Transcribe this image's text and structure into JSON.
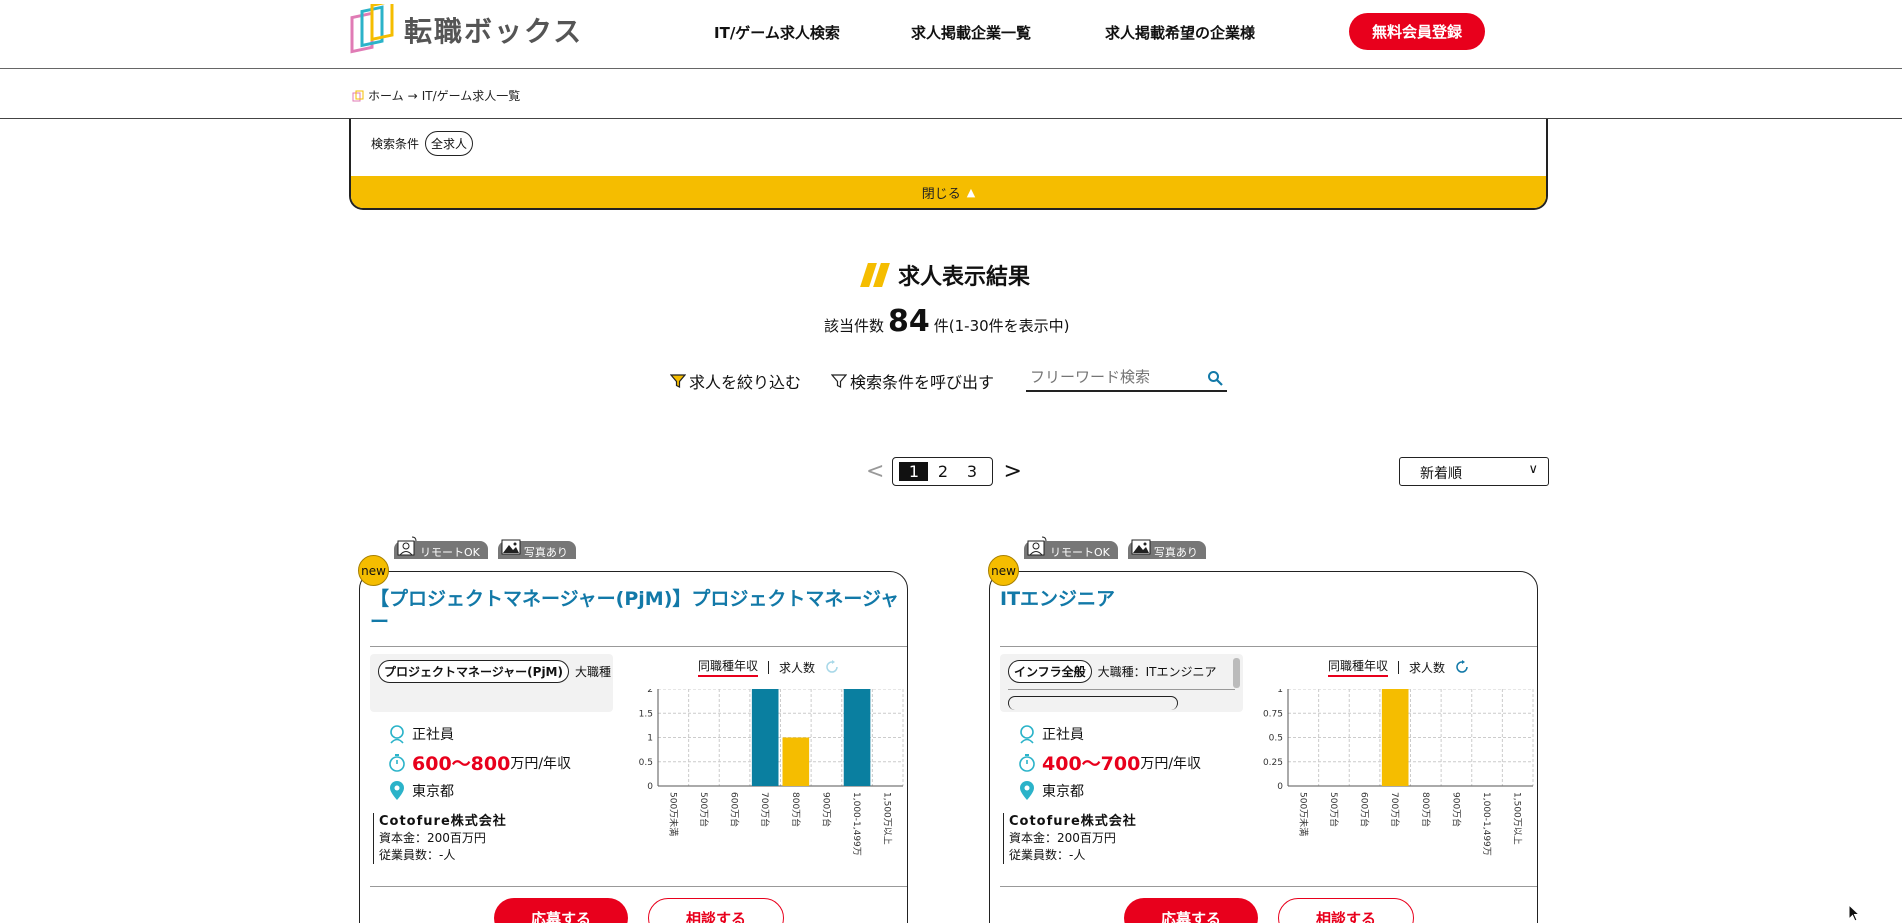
{
  "header": {
    "logo_text": "転職ボックス",
    "nav": [
      "IT/ゲーム求人検索",
      "求人掲載企業一覧",
      "求人掲載希望の企業様"
    ],
    "cta": "無料会員登録"
  },
  "breadcrumb": {
    "home": "ホーム",
    "arrow": "→",
    "current": "IT/ゲーム求人一覧"
  },
  "search_panel": {
    "condition_label": "検索条件",
    "condition_value": "全求人",
    "close_label": "閉じる"
  },
  "results": {
    "title": "求人表示結果",
    "count_prefix": "該当件数",
    "count": "84",
    "count_suffix": "件(1-30件を表示中)",
    "filter_label": "求人を絞り込む",
    "saved_label": "検索条件を呼び出す",
    "search_placeholder": "フリーワード検索"
  },
  "pager": {
    "prev": "<",
    "pages": [
      "1",
      "2",
      "3"
    ],
    "active": "1",
    "next": ">"
  },
  "sort": {
    "selected": "新着順"
  },
  "cards": [
    {
      "new_label": "new",
      "tags": [
        "リモートOK",
        "写真あり"
      ],
      "title": "【プロジェクトマネージャー(PjM)】プロジェクトマネージャー",
      "category_chip": "プロジェクトマネージャー(PjM)",
      "category_text": "大職種",
      "employment": "正社員",
      "salary": "600〜800",
      "salary_unit": "万円/年収",
      "location": "東京都",
      "company": "Cotofure株式会社",
      "capital": "資本金：200百万円",
      "employees": "従業員数：-人",
      "chart_tab_1": "同職種年収",
      "chart_tab_2": "求人数",
      "apply": "応募する",
      "consult": "相談する"
    },
    {
      "new_label": "new",
      "tags": [
        "リモートOK",
        "写真あり"
      ],
      "title": "ITエンジニア",
      "category_chip": "インフラ全般",
      "category_text": "大職種：ITエンジニア",
      "employment": "正社員",
      "salary": "400〜700",
      "salary_unit": "万円/年収",
      "location": "東京都",
      "company": "Cotofure株式会社",
      "capital": "資本金：200百万円",
      "employees": "従業員数：-人",
      "chart_tab_1": "同職種年収",
      "chart_tab_2": "求人数",
      "apply": "応募する",
      "consult": "相談する"
    }
  ],
  "colors": {
    "accent_red": "#e8001c",
    "accent_yellow": "#f5bd00",
    "teal": "#0a7fa0",
    "title_blue": "#1279a8"
  },
  "chart_data": [
    {
      "type": "bar",
      "categories": [
        "500万未満",
        "500万台",
        "600万台",
        "700万台",
        "800万台",
        "900万台",
        "1,000-1,499万",
        "1,500万以上"
      ],
      "values": [
        0,
        0,
        0,
        2,
        1,
        0,
        2,
        0
      ],
      "highlight": [
        false,
        false,
        false,
        false,
        true,
        false,
        false,
        false
      ],
      "yticks": [
        "0",
        "0.5",
        "1",
        "1.5",
        "2"
      ],
      "ylim": [
        0,
        2
      ]
    },
    {
      "type": "bar",
      "categories": [
        "500万未満",
        "500万台",
        "600万台",
        "700万台",
        "800万台",
        "900万台",
        "1,000-1,499万",
        "1,500万以上"
      ],
      "values": [
        0,
        0,
        0,
        1,
        0,
        0,
        0,
        0
      ],
      "highlight": [
        false,
        false,
        false,
        true,
        false,
        false,
        false,
        false
      ],
      "yticks": [
        "0",
        "0.25",
        "0.5",
        "0.75",
        "1"
      ],
      "ylim": [
        0,
        1
      ]
    }
  ]
}
